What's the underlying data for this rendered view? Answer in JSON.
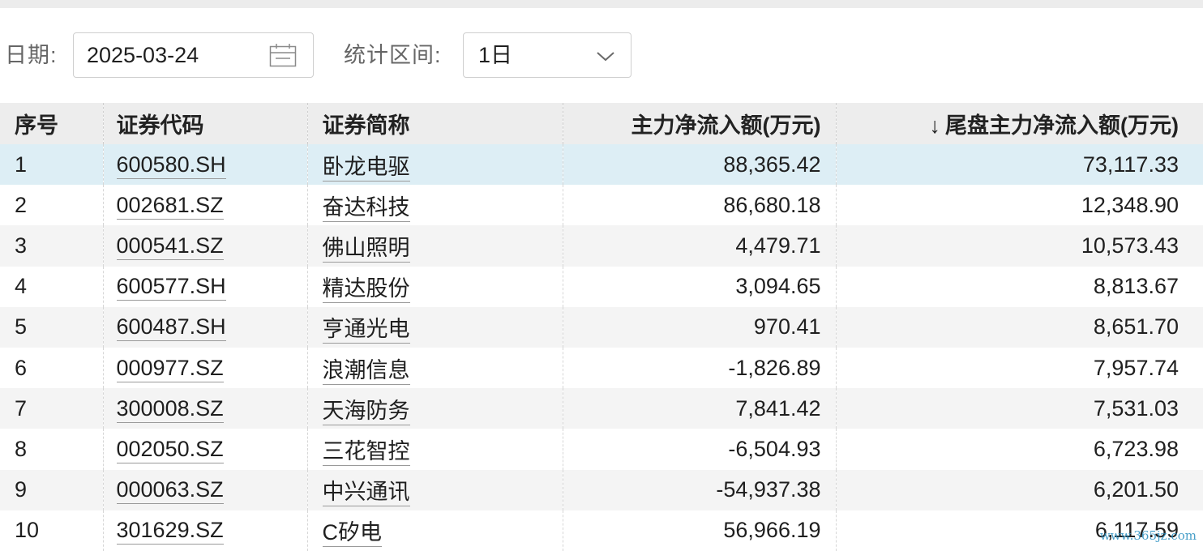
{
  "filters": {
    "date_label": "日期:",
    "date_value": "2025-03-24",
    "period_label": "统计区间:",
    "period_value": "1日"
  },
  "table": {
    "headers": {
      "index": "序号",
      "code": "证券代码",
      "name": "证券简称",
      "main_net_inflow": "主力净流入额(万元)",
      "tail_main_net_inflow": "尾盘主力净流入额(万元)",
      "sort_indicator": "↓"
    },
    "rows": [
      {
        "index": "1",
        "code": "600580.SH",
        "name": "卧龙电驱",
        "main_net_inflow": "88,365.42",
        "tail_main_net_inflow": "73,117.33"
      },
      {
        "index": "2",
        "code": "002681.SZ",
        "name": "奋达科技",
        "main_net_inflow": "86,680.18",
        "tail_main_net_inflow": "12,348.90"
      },
      {
        "index": "3",
        "code": "000541.SZ",
        "name": "佛山照明",
        "main_net_inflow": "4,479.71",
        "tail_main_net_inflow": "10,573.43"
      },
      {
        "index": "4",
        "code": "600577.SH",
        "name": "精达股份",
        "main_net_inflow": "3,094.65",
        "tail_main_net_inflow": "8,813.67"
      },
      {
        "index": "5",
        "code": "600487.SH",
        "name": "亨通光电",
        "main_net_inflow": "970.41",
        "tail_main_net_inflow": "8,651.70"
      },
      {
        "index": "6",
        "code": "000977.SZ",
        "name": "浪潮信息",
        "main_net_inflow": "-1,826.89",
        "tail_main_net_inflow": "7,957.74"
      },
      {
        "index": "7",
        "code": "300008.SZ",
        "name": "天海防务",
        "main_net_inflow": "7,841.42",
        "tail_main_net_inflow": "7,531.03"
      },
      {
        "index": "8",
        "code": "002050.SZ",
        "name": "三花智控",
        "main_net_inflow": "-6,504.93",
        "tail_main_net_inflow": "6,723.98"
      },
      {
        "index": "9",
        "code": "000063.SZ",
        "name": "中兴通讯",
        "main_net_inflow": "-54,937.38",
        "tail_main_net_inflow": "6,201.50"
      },
      {
        "index": "10",
        "code": "301629.SZ",
        "name": "C矽电",
        "main_net_inflow": "56,966.19",
        "tail_main_net_inflow": "6,117.59"
      }
    ]
  },
  "watermark": "www.365jz.com",
  "colors": {
    "selected_row": "#ddeef5",
    "header_bg": "#ededed",
    "stripe": "#f4f4f4"
  }
}
